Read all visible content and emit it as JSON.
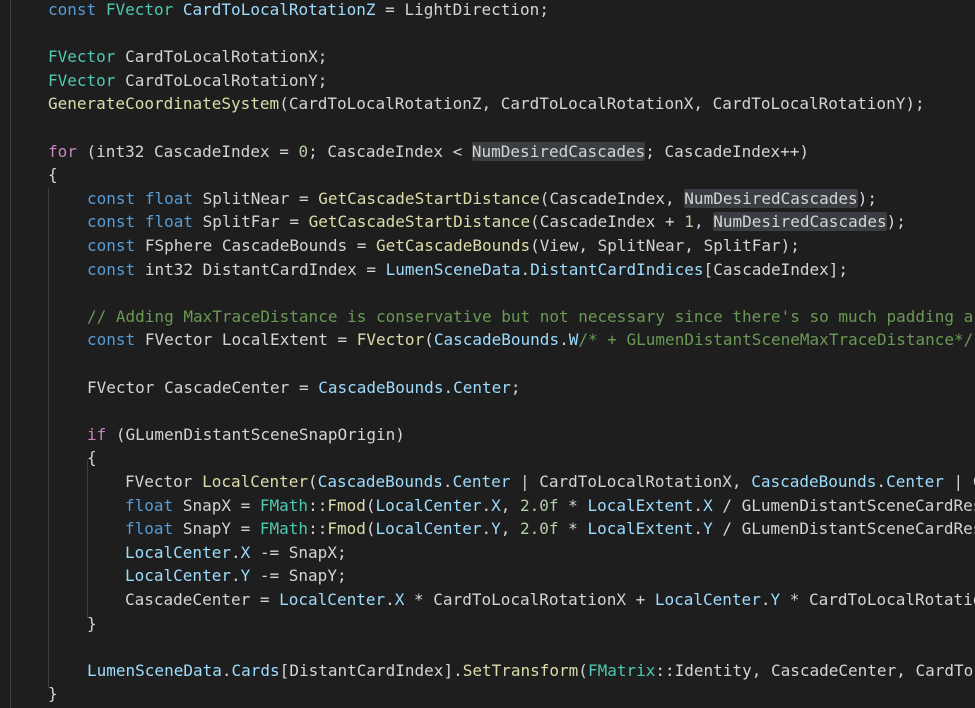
{
  "editor": {
    "theme": {
      "background": "#1e1e1e",
      "keyword": "#569cd6",
      "control": "#c586c0",
      "type": "#4ec9b0",
      "function": "#dcdcaa",
      "variable": "#9cdcfe",
      "number": "#b5cea8",
      "comment": "#6a9955",
      "plain": "#d4d4d4",
      "highlight": "#3a3d41"
    },
    "lines": [
      {
        "indent": 1,
        "tokens": [
          [
            "const",
            "kw"
          ],
          [
            " ",
            "p"
          ],
          [
            "FVector",
            "ty"
          ],
          [
            " ",
            "p"
          ],
          [
            "CardToLocalRotationZ",
            "var"
          ],
          [
            " = ",
            "p"
          ],
          [
            "LightDirection",
            "p"
          ],
          [
            ";",
            "p"
          ]
        ]
      },
      {
        "indent": 1,
        "tokens": []
      },
      {
        "indent": 1,
        "tokens": [
          [
            "FVector",
            "ty"
          ],
          [
            " ",
            "p"
          ],
          [
            "CardToLocalRotationX",
            "p"
          ],
          [
            ";",
            "p"
          ]
        ]
      },
      {
        "indent": 1,
        "tokens": [
          [
            "FVector",
            "ty"
          ],
          [
            " ",
            "p"
          ],
          [
            "CardToLocalRotationY",
            "p"
          ],
          [
            ";",
            "p"
          ]
        ]
      },
      {
        "indent": 1,
        "tokens": [
          [
            "GenerateCoordinateSystem",
            "fn"
          ],
          [
            "(",
            "p"
          ],
          [
            "CardToLocalRotationZ",
            "p"
          ],
          [
            ", ",
            "p"
          ],
          [
            "CardToLocalRotationX",
            "p"
          ],
          [
            ", ",
            "p"
          ],
          [
            "CardToLocalRotationY",
            "p"
          ],
          [
            ");",
            "p"
          ]
        ]
      },
      {
        "indent": 1,
        "tokens": []
      },
      {
        "indent": 1,
        "tokens": [
          [
            "for",
            "ctl"
          ],
          [
            " (",
            "p"
          ],
          [
            "int32",
            "p"
          ],
          [
            " ",
            "p"
          ],
          [
            "CascadeIndex",
            "p"
          ],
          [
            " = ",
            "p"
          ],
          [
            "0",
            "num"
          ],
          [
            "; ",
            "p"
          ],
          [
            "CascadeIndex",
            "p"
          ],
          [
            " < ",
            "p"
          ],
          [
            "NumDesiredCascades",
            "hl"
          ],
          [
            "; ",
            "p"
          ],
          [
            "CascadeIndex",
            "p"
          ],
          [
            "++)",
            "p"
          ]
        ]
      },
      {
        "indent": 1,
        "tokens": [
          [
            "{",
            "p"
          ]
        ]
      },
      {
        "indent": 2,
        "tokens": [
          [
            "const",
            "kw"
          ],
          [
            " ",
            "p"
          ],
          [
            "float",
            "kw"
          ],
          [
            " ",
            "p"
          ],
          [
            "SplitNear",
            "p"
          ],
          [
            " = ",
            "p"
          ],
          [
            "GetCascadeStartDistance",
            "fn"
          ],
          [
            "(",
            "p"
          ],
          [
            "CascadeIndex",
            "p"
          ],
          [
            ", ",
            "p"
          ],
          [
            "NumDesiredCascades",
            "hl"
          ],
          [
            ");",
            "p"
          ]
        ]
      },
      {
        "indent": 2,
        "tokens": [
          [
            "const",
            "kw"
          ],
          [
            " ",
            "p"
          ],
          [
            "float",
            "kw"
          ],
          [
            " ",
            "p"
          ],
          [
            "SplitFar",
            "p"
          ],
          [
            " = ",
            "p"
          ],
          [
            "GetCascadeStartDistance",
            "fn"
          ],
          [
            "(",
            "p"
          ],
          [
            "CascadeIndex",
            "p"
          ],
          [
            " + ",
            "p"
          ],
          [
            "1",
            "num"
          ],
          [
            ", ",
            "p"
          ],
          [
            "NumDesiredCascades",
            "hl"
          ],
          [
            ");",
            "p"
          ]
        ]
      },
      {
        "indent": 2,
        "tokens": [
          [
            "const",
            "kw"
          ],
          [
            " ",
            "p"
          ],
          [
            "FSphere",
            "p"
          ],
          [
            " ",
            "p"
          ],
          [
            "CascadeBounds",
            "p"
          ],
          [
            " = ",
            "p"
          ],
          [
            "GetCascadeBounds",
            "fn"
          ],
          [
            "(",
            "p"
          ],
          [
            "View",
            "p"
          ],
          [
            ", ",
            "p"
          ],
          [
            "SplitNear",
            "p"
          ],
          [
            ", ",
            "p"
          ],
          [
            "SplitFar",
            "p"
          ],
          [
            ");",
            "p"
          ]
        ]
      },
      {
        "indent": 2,
        "tokens": [
          [
            "const",
            "kw"
          ],
          [
            " ",
            "p"
          ],
          [
            "int32",
            "p"
          ],
          [
            " ",
            "p"
          ],
          [
            "DistantCardIndex",
            "p"
          ],
          [
            " = ",
            "p"
          ],
          [
            "LumenSceneData",
            "var"
          ],
          [
            ".",
            "p"
          ],
          [
            "DistantCardIndices",
            "var"
          ],
          [
            "[",
            "p"
          ],
          [
            "CascadeIndex",
            "p"
          ],
          [
            "];",
            "p"
          ]
        ]
      },
      {
        "indent": 2,
        "tokens": []
      },
      {
        "indent": 2,
        "tokens": [
          [
            "// Adding MaxTraceDistance is conservative but not necessary since there's so much padding ar",
            "cm"
          ]
        ]
      },
      {
        "indent": 2,
        "tokens": [
          [
            "const",
            "kw"
          ],
          [
            " ",
            "p"
          ],
          [
            "FVector",
            "p"
          ],
          [
            " ",
            "p"
          ],
          [
            "LocalExtent",
            "p"
          ],
          [
            " = ",
            "p"
          ],
          [
            "FVector",
            "fn"
          ],
          [
            "(",
            "p"
          ],
          [
            "CascadeBounds",
            "var"
          ],
          [
            ".",
            "p"
          ],
          [
            "W",
            "var"
          ],
          [
            "/* + GLumenDistantSceneMaxTraceDistance*/",
            "cm"
          ],
          [
            ")",
            "p"
          ]
        ]
      },
      {
        "indent": 2,
        "tokens": []
      },
      {
        "indent": 2,
        "tokens": [
          [
            "FVector",
            "p"
          ],
          [
            " ",
            "p"
          ],
          [
            "CascadeCenter",
            "p"
          ],
          [
            " = ",
            "p"
          ],
          [
            "CascadeBounds",
            "var"
          ],
          [
            ".",
            "p"
          ],
          [
            "Center",
            "var"
          ],
          [
            ";",
            "p"
          ]
        ]
      },
      {
        "indent": 2,
        "tokens": []
      },
      {
        "indent": 2,
        "tokens": [
          [
            "if",
            "ctl"
          ],
          [
            " (",
            "p"
          ],
          [
            "GLumenDistantSceneSnapOrigin",
            "p"
          ],
          [
            ")",
            "p"
          ]
        ]
      },
      {
        "indent": 2,
        "tokens": [
          [
            "{",
            "p"
          ]
        ]
      },
      {
        "indent": 3,
        "tokens": [
          [
            "FVector",
            "p"
          ],
          [
            " ",
            "p"
          ],
          [
            "LocalCenter",
            "fn"
          ],
          [
            "(",
            "p"
          ],
          [
            "CascadeBounds",
            "var"
          ],
          [
            ".",
            "p"
          ],
          [
            "Center",
            "var"
          ],
          [
            " | ",
            "p"
          ],
          [
            "CardToLocalRotationX",
            "p"
          ],
          [
            ", ",
            "p"
          ],
          [
            "CascadeBounds",
            "var"
          ],
          [
            ".",
            "p"
          ],
          [
            "Center",
            "var"
          ],
          [
            " | C",
            "p"
          ]
        ]
      },
      {
        "indent": 3,
        "tokens": [
          [
            "float",
            "kw"
          ],
          [
            " ",
            "p"
          ],
          [
            "SnapX",
            "p"
          ],
          [
            " = ",
            "p"
          ],
          [
            "FMath",
            "ty"
          ],
          [
            "::",
            "p"
          ],
          [
            "Fmod",
            "fn"
          ],
          [
            "(",
            "p"
          ],
          [
            "LocalCenter",
            "var"
          ],
          [
            ".",
            "p"
          ],
          [
            "X",
            "var"
          ],
          [
            ", ",
            "p"
          ],
          [
            "2.0f",
            "num"
          ],
          [
            " * ",
            "p"
          ],
          [
            "LocalExtent",
            "var"
          ],
          [
            ".",
            "p"
          ],
          [
            "X",
            "var"
          ],
          [
            " / ",
            "p"
          ],
          [
            "GLumenDistantSceneCardRes",
            "p"
          ]
        ]
      },
      {
        "indent": 3,
        "tokens": [
          [
            "float",
            "kw"
          ],
          [
            " ",
            "p"
          ],
          [
            "SnapY",
            "p"
          ],
          [
            " = ",
            "p"
          ],
          [
            "FMath",
            "ty"
          ],
          [
            "::",
            "p"
          ],
          [
            "Fmod",
            "fn"
          ],
          [
            "(",
            "p"
          ],
          [
            "LocalCenter",
            "var"
          ],
          [
            ".",
            "p"
          ],
          [
            "Y",
            "var"
          ],
          [
            ", ",
            "p"
          ],
          [
            "2.0f",
            "num"
          ],
          [
            " * ",
            "p"
          ],
          [
            "LocalExtent",
            "var"
          ],
          [
            ".",
            "p"
          ],
          [
            "Y",
            "var"
          ],
          [
            " / ",
            "p"
          ],
          [
            "GLumenDistantSceneCardRes",
            "p"
          ]
        ]
      },
      {
        "indent": 3,
        "tokens": [
          [
            "LocalCenter",
            "var"
          ],
          [
            ".",
            "p"
          ],
          [
            "X",
            "var"
          ],
          [
            " -= ",
            "p"
          ],
          [
            "SnapX",
            "p"
          ],
          [
            ";",
            "p"
          ]
        ]
      },
      {
        "indent": 3,
        "tokens": [
          [
            "LocalCenter",
            "var"
          ],
          [
            ".",
            "p"
          ],
          [
            "Y",
            "var"
          ],
          [
            " -= ",
            "p"
          ],
          [
            "SnapY",
            "p"
          ],
          [
            ";",
            "p"
          ]
        ]
      },
      {
        "indent": 3,
        "tokens": [
          [
            "CascadeCenter",
            "p"
          ],
          [
            " = ",
            "p"
          ],
          [
            "LocalCenter",
            "var"
          ],
          [
            ".",
            "p"
          ],
          [
            "X",
            "var"
          ],
          [
            " * ",
            "p"
          ],
          [
            "CardToLocalRotationX",
            "p"
          ],
          [
            " + ",
            "p"
          ],
          [
            "LocalCenter",
            "var"
          ],
          [
            ".",
            "p"
          ],
          [
            "Y",
            "var"
          ],
          [
            " * ",
            "p"
          ],
          [
            "CardToLocalRotatio",
            "p"
          ]
        ]
      },
      {
        "indent": 2,
        "tokens": [
          [
            "}",
            "p"
          ]
        ]
      },
      {
        "indent": 2,
        "tokens": []
      },
      {
        "indent": 2,
        "tokens": [
          [
            "LumenSceneData",
            "var"
          ],
          [
            ".",
            "p"
          ],
          [
            "Cards",
            "var"
          ],
          [
            "[",
            "p"
          ],
          [
            "DistantCardIndex",
            "p"
          ],
          [
            "].",
            "p"
          ],
          [
            "SetTransform",
            "fn"
          ],
          [
            "(",
            "p"
          ],
          [
            "FMatrix",
            "ty"
          ],
          [
            "::",
            "p"
          ],
          [
            "Identity",
            "p"
          ],
          [
            ", ",
            "p"
          ],
          [
            "CascadeCenter",
            "p"
          ],
          [
            ", ",
            "p"
          ],
          [
            "CardTo",
            "p"
          ]
        ]
      },
      {
        "indent": 1,
        "tokens": [
          [
            "}",
            "p"
          ]
        ]
      }
    ]
  }
}
